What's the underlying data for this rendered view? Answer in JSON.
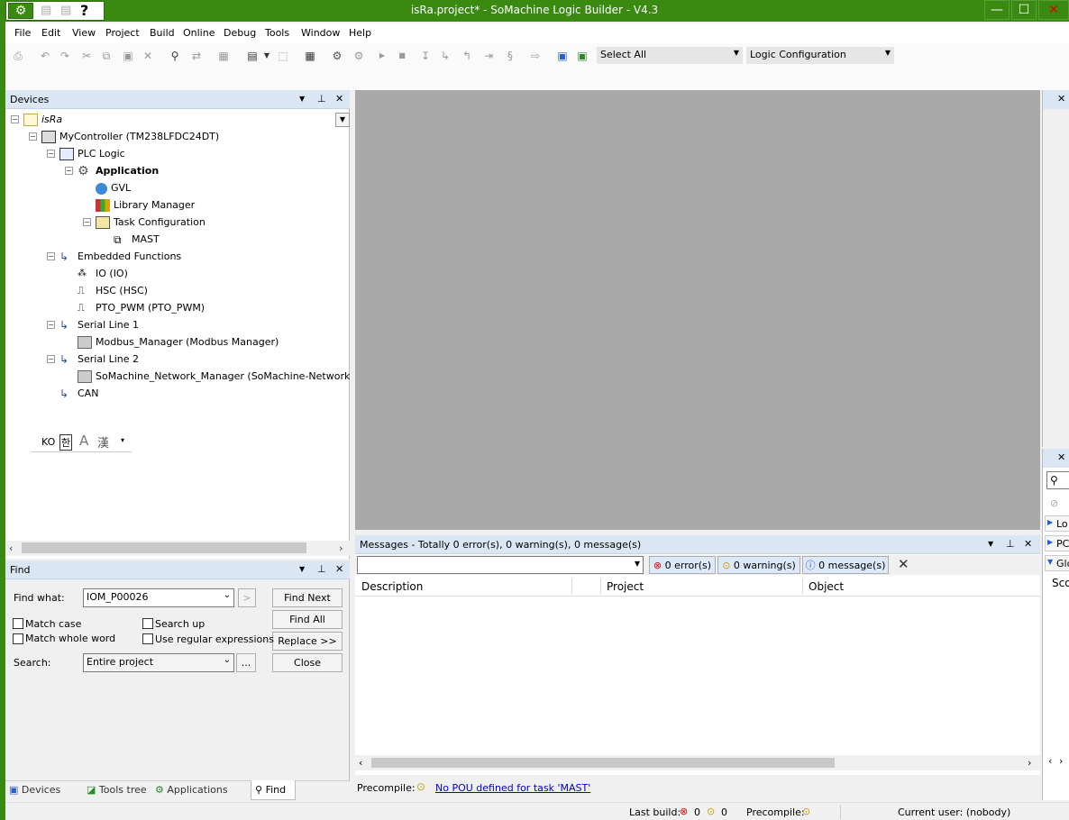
{
  "window": {
    "title": "isRa.project* - SoMachine Logic Builder - V4.3",
    "help_glyph": "?",
    "min": "—",
    "max": "☐",
    "close": "✕"
  },
  "menu": [
    "File",
    "Edit",
    "View",
    "Project",
    "Build",
    "Online",
    "Debug",
    "Tools",
    "Window",
    "Help"
  ],
  "toolbar": {
    "select_all": "Select All",
    "logic_config": "Logic Configuration"
  },
  "devices": {
    "title": "Devices",
    "items": [
      {
        "label": "isRa",
        "icon": "project-icon"
      },
      {
        "label": "MyController (TM238LFDC24DT)",
        "icon": "controller-icon"
      },
      {
        "label": "PLC Logic",
        "icon": "plc-logic-icon"
      },
      {
        "label": "Application",
        "icon": "application-gear-icon"
      },
      {
        "label": "GVL",
        "icon": "globe-icon"
      },
      {
        "label": "Library Manager",
        "icon": "library-icon"
      },
      {
        "label": "Task Configuration",
        "icon": "task-config-icon"
      },
      {
        "label": "MAST",
        "icon": "task-icon"
      },
      {
        "label": "Embedded Functions",
        "icon": "connector-icon"
      },
      {
        "label": "IO (IO)",
        "icon": "io-icon"
      },
      {
        "label": "HSC (HSC)",
        "icon": "hsc-pulse-icon"
      },
      {
        "label": "PTO_PWM (PTO_PWM)",
        "icon": "pwm-pulse-icon"
      },
      {
        "label": "Serial Line 1",
        "icon": "connector-icon"
      },
      {
        "label": "Modbus_Manager (Modbus Manager)",
        "icon": "module-icon"
      },
      {
        "label": "Serial Line 2",
        "icon": "connector-icon"
      },
      {
        "label": "SoMachine_Network_Manager (SoMachine-Network Manag",
        "icon": "module-icon"
      },
      {
        "label": "CAN",
        "icon": "connector-icon"
      }
    ]
  },
  "ime": {
    "lang": "KO",
    "hangul": "한"
  },
  "find": {
    "title": "Find",
    "find_what_label": "Find what:",
    "find_what_value": "IOM_P00026",
    "match_case": "Match case",
    "match_whole_word": "Match whole word",
    "search_up": "Search up",
    "use_regex": "Use regular expressions",
    "search_label": "Search:",
    "search_value": "Entire project",
    "browse": "...",
    "arrow": ">",
    "find_next": "Find Next",
    "find_all": "Find All",
    "replace": "Replace >>",
    "close": "Close"
  },
  "tabs": [
    "Devices tree",
    "Tools tree",
    "Applications tree",
    "Find"
  ],
  "messages": {
    "title": "Messages - Totally 0 error(s), 0 warning(s), 0 message(s)",
    "errors": "0 error(s)",
    "warnings": "0 warning(s)",
    "messages": "0 message(s)",
    "columns": [
      "Description",
      "Project",
      "Object"
    ],
    "precompile_label": "Precompile:",
    "precompile_link": "No POU defined for task 'MAST'"
  },
  "status": {
    "last_build_label": "Last build:",
    "errors": "0",
    "warnings": "0",
    "precompile_label": "Precompile:",
    "current_user": "Current user: (nobody)"
  },
  "right_panel": {
    "items": [
      "Lo",
      "PC",
      "Glo"
    ],
    "scope": "Sco"
  },
  "colors": {
    "title_green": "#3a8a12",
    "panel_head": "#dbe6f4",
    "editor_gray": "#a9a9a9",
    "link": "#0000cc"
  }
}
